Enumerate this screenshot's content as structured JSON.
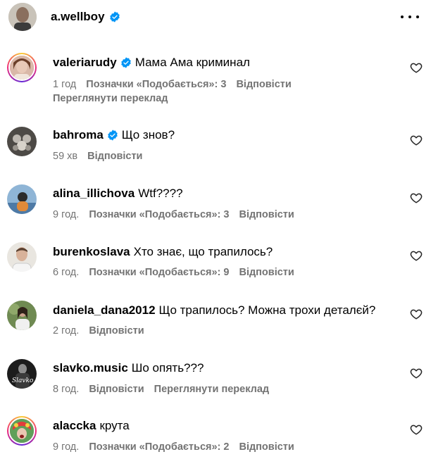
{
  "header": {
    "username": "a.wellboy",
    "verified": true,
    "more_icon": "more-horizontal-icon"
  },
  "labels": {
    "likes_prefix": "Позначки «Подобається»:",
    "reply": "Відповісти",
    "see_translation": "Переглянути переклад"
  },
  "comments": [
    {
      "username": "valeriarudy",
      "verified": true,
      "text": "Мама Ама криминал",
      "time": "1 год",
      "likes_text": "Позначки «Подобається»: 3",
      "reply": "Відповісти",
      "translate": "Переглянути переклад"
    },
    {
      "username": "bahroma",
      "verified": true,
      "text": "Що знов?",
      "time": "59 хв",
      "reply": "Відповісти"
    },
    {
      "username": "alina_illichova",
      "verified": false,
      "text": "Wtf????",
      "time": "9 год.",
      "likes_text": "Позначки «Подобається»: 3",
      "reply": "Відповісти"
    },
    {
      "username": "burenkoslava",
      "verified": false,
      "text": "Хто знає, що трапилось?",
      "time": "6 год.",
      "likes_text": "Позначки «Подобається»: 9",
      "reply": "Відповісти"
    },
    {
      "username": "daniela_dana2012",
      "verified": false,
      "text": "Що трапилось? Можна трохи деталєй?",
      "time": "2 год.",
      "reply": "Відповісти"
    },
    {
      "username": "slavko.music",
      "verified": false,
      "text": "Шо опять???",
      "time": "8 год.",
      "reply": "Відповісти",
      "translate_inline": "Переглянути переклад"
    },
    {
      "username": "alaccka",
      "verified": false,
      "text": "крута",
      "time": "9 год.",
      "likes_text": "Позначки «Подобається»: 2",
      "reply": "Відповісти"
    }
  ],
  "colors": {
    "verified_blue": "#0095f6",
    "secondary_text": "#737373"
  }
}
